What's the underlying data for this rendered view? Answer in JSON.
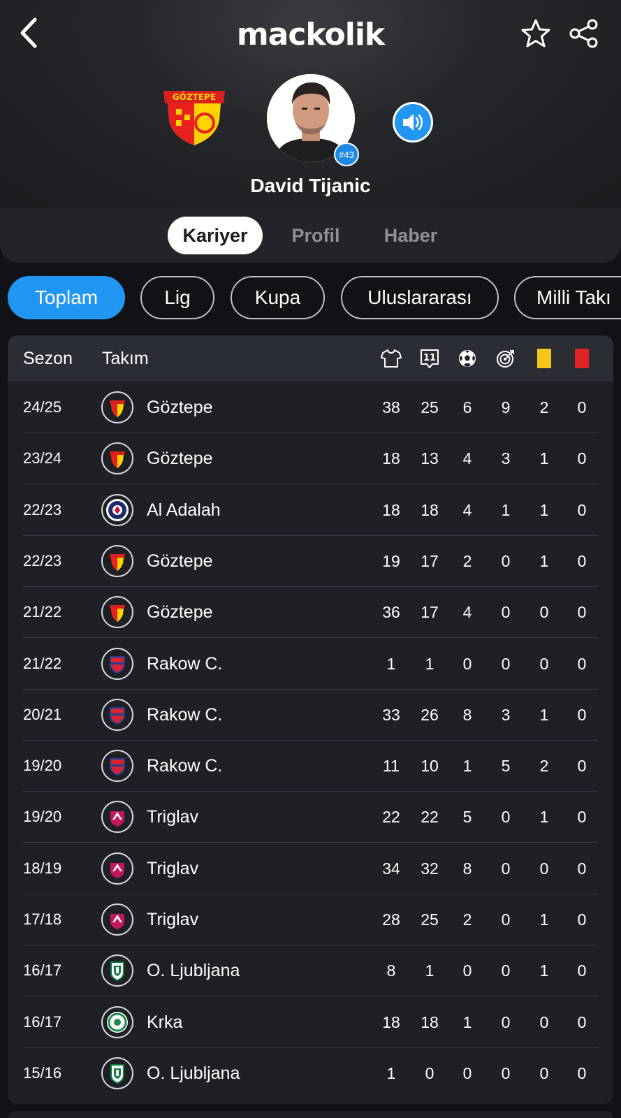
{
  "app": {
    "brand": "mackolik"
  },
  "player": {
    "name": "David Tijanic",
    "number": "#43",
    "club_crest_text": "GÖZTEPE"
  },
  "tabs": [
    {
      "label": "Kariyer",
      "active": true
    },
    {
      "label": "Profil",
      "active": false
    },
    {
      "label": "Haber",
      "active": false
    }
  ],
  "filters": [
    {
      "label": "Toplam",
      "active": true
    },
    {
      "label": "Lig",
      "active": false
    },
    {
      "label": "Kupa",
      "active": false
    },
    {
      "label": "Uluslararası",
      "active": false
    },
    {
      "label": "Milli Takı",
      "active": false
    }
  ],
  "table": {
    "headers": {
      "season": "Sezon",
      "team": "Takım"
    },
    "stat_icons": [
      "shirt-icon",
      "lineup-icon",
      "ball-icon",
      "target-icon",
      "yellow-card-icon",
      "red-card-icon"
    ],
    "rows": [
      {
        "season": "24/25",
        "team": "Göztepe",
        "club": "goztepe",
        "stats": [
          "38",
          "25",
          "6",
          "9",
          "2",
          "0"
        ]
      },
      {
        "season": "23/24",
        "team": "Göztepe",
        "club": "goztepe",
        "stats": [
          "18",
          "13",
          "4",
          "3",
          "1",
          "0"
        ]
      },
      {
        "season": "22/23",
        "team": "Al Adalah",
        "club": "adalah",
        "stats": [
          "18",
          "18",
          "4",
          "1",
          "1",
          "0"
        ]
      },
      {
        "season": "22/23",
        "team": "Göztepe",
        "club": "goztepe",
        "stats": [
          "19",
          "17",
          "2",
          "0",
          "1",
          "0"
        ]
      },
      {
        "season": "21/22",
        "team": "Göztepe",
        "club": "goztepe",
        "stats": [
          "36",
          "17",
          "4",
          "0",
          "0",
          "0"
        ]
      },
      {
        "season": "21/22",
        "team": "Rakow C.",
        "club": "rakow",
        "stats": [
          "1",
          "1",
          "0",
          "0",
          "0",
          "0"
        ]
      },
      {
        "season": "20/21",
        "team": "Rakow C.",
        "club": "rakow",
        "stats": [
          "33",
          "26",
          "8",
          "3",
          "1",
          "0"
        ]
      },
      {
        "season": "19/20",
        "team": "Rakow C.",
        "club": "rakow",
        "stats": [
          "11",
          "10",
          "1",
          "5",
          "2",
          "0"
        ]
      },
      {
        "season": "19/20",
        "team": "Triglav",
        "club": "triglav",
        "stats": [
          "22",
          "22",
          "5",
          "0",
          "1",
          "0"
        ]
      },
      {
        "season": "18/19",
        "team": "Triglav",
        "club": "triglav",
        "stats": [
          "34",
          "32",
          "8",
          "0",
          "0",
          "0"
        ]
      },
      {
        "season": "17/18",
        "team": "Triglav",
        "club": "triglav",
        "stats": [
          "28",
          "25",
          "2",
          "0",
          "1",
          "0"
        ]
      },
      {
        "season": "16/17",
        "team": "O. Ljubljana",
        "club": "olimpija",
        "stats": [
          "8",
          "1",
          "0",
          "0",
          "1",
          "0"
        ]
      },
      {
        "season": "16/17",
        "team": "Krka",
        "club": "krka",
        "stats": [
          "18",
          "18",
          "1",
          "0",
          "0",
          "0"
        ]
      },
      {
        "season": "15/16",
        "team": "O. Ljubljana",
        "club": "olimpija",
        "stats": [
          "1",
          "0",
          "0",
          "0",
          "0",
          "0"
        ]
      }
    ]
  },
  "colors": {
    "accent": "#2196f3",
    "yellow_card": "#f5c518",
    "red_card": "#e02424",
    "card_bg": "#1e2025"
  }
}
